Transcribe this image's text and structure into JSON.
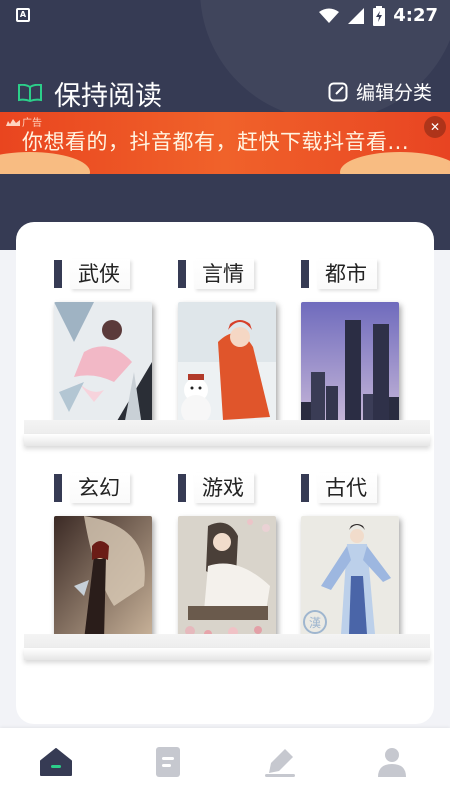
{
  "status_bar": {
    "time": "4:27",
    "app_icon": "A",
    "icons": [
      "wifi-icon",
      "signal-icon",
      "battery-icon"
    ]
  },
  "header": {
    "title": "保持阅读",
    "title_icon": "book-open-icon",
    "edit_label": "编辑分类",
    "edit_icon": "edit-icon"
  },
  "ad": {
    "label": "广告",
    "text": "你想看的，抖音都有，赶快下载抖音看...",
    "close_icon": "close-icon"
  },
  "categories": [
    {
      "label": "武侠",
      "cover": "wuxia-cover"
    },
    {
      "label": "言情",
      "cover": "romance-cover"
    },
    {
      "label": "都市",
      "cover": "city-cover"
    },
    {
      "label": "玄幻",
      "cover": "fantasy-cover"
    },
    {
      "label": "游戏",
      "cover": "game-cover"
    },
    {
      "label": "古代",
      "cover": "ancient-cover"
    }
  ],
  "bottom_nav": [
    {
      "icon": "home-icon",
      "active": true
    },
    {
      "icon": "document-icon",
      "active": false
    },
    {
      "icon": "pen-icon",
      "active": false
    },
    {
      "icon": "user-icon",
      "active": false
    }
  ],
  "colors": {
    "header_bg": "#363b54",
    "ad_bg": "#e9451f",
    "accent_green": "#2ccf8a",
    "nav_inactive": "#c6c8cf"
  }
}
